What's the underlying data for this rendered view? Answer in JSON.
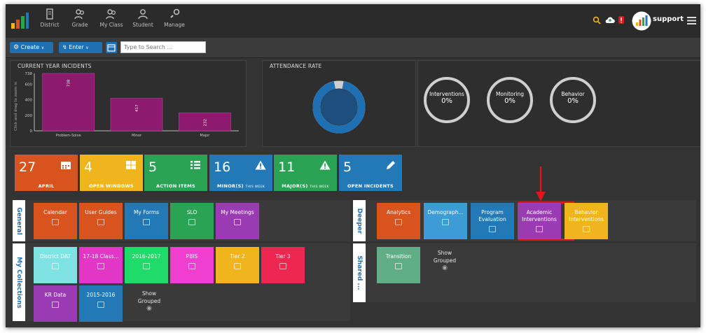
{
  "nav": {
    "items": [
      {
        "label": "District",
        "icon": "building-icon"
      },
      {
        "label": "Grade",
        "icon": "users-icon"
      },
      {
        "label": "My Class",
        "icon": "class-icon"
      },
      {
        "label": "Student",
        "icon": "user-icon"
      },
      {
        "label": "Manage",
        "icon": "manage-icon"
      }
    ],
    "user": "support"
  },
  "toolbar": {
    "create_label": "Create",
    "enter_label": "Enter",
    "search_placeholder": "Type to Search ..."
  },
  "panels": {
    "incidents_title": "CURRENT YEAR INCIDENTS",
    "incidents_axis_hint": "Click and drag to zoom in",
    "attendance_title": "ATTENDANCE RATE",
    "rings": [
      {
        "label": "Interventions",
        "value": "0%"
      },
      {
        "label": "Monitoring",
        "value": "0%"
      },
      {
        "label": "Behavior",
        "value": "0%"
      }
    ]
  },
  "chart_data": {
    "type": "bar",
    "title": "CURRENT YEAR INCIDENTS",
    "categories": [
      "Problem-Solve",
      "Minor",
      "Major"
    ],
    "values": [
      738,
      417,
      232
    ],
    "y_ticks": [
      "0",
      "200",
      "400",
      "600",
      "738"
    ],
    "ylim": [
      0,
      738
    ],
    "bar_color": "#8e1a6e"
  },
  "attendance": {
    "fraction": 0.94,
    "color": "#1f6fb3"
  },
  "stats": [
    {
      "num": "27",
      "label": "APRIL",
      "sub": "",
      "color": "#d9531e",
      "icon": "calendar-icon"
    },
    {
      "num": "4",
      "label": "OPEN WINDOWS",
      "sub": "",
      "color": "#f0b41c",
      "icon": "windows-icon"
    },
    {
      "num": "5",
      "label": "ACTION ITEMS",
      "sub": "",
      "color": "#2aa355",
      "icon": "list-icon"
    },
    {
      "num": "16",
      "label": "MINOR(S)",
      "sub": "THIS WEEK",
      "color": "#2279b5",
      "icon": "warning-icon"
    },
    {
      "num": "11",
      "label": "MAJOR(S)",
      "sub": "THIS WEEK",
      "color": "#2aa355",
      "icon": "warning-icon"
    },
    {
      "num": "5",
      "label": "OPEN INCIDENTS",
      "sub": "",
      "color": "#2279b5",
      "icon": "pencil-icon"
    }
  ],
  "groups": {
    "general": {
      "title": "General",
      "tiles": [
        {
          "label": "Calendar",
          "color": "#d9531e",
          "icon": "calendar-icon"
        },
        {
          "label": "User Guides",
          "color": "#d9531e",
          "icon": "help-icon"
        },
        {
          "label": "My Forms",
          "color": "#2279b5",
          "icon": "form-icon"
        },
        {
          "label": "SLO",
          "color": "#2aa355",
          "icon": "chart-icon"
        },
        {
          "label": "My Meetings",
          "color": "#9b3bb3",
          "icon": "meeting-icon"
        }
      ]
    },
    "collections": {
      "title": "My Collections",
      "tiles": [
        {
          "label": "District DAT",
          "color": "#7fe3e3",
          "icon": "collection-icon"
        },
        {
          "label": "17-18 Class...",
          "color": "#e236c7",
          "icon": "collection-icon"
        },
        {
          "label": "2016-2017",
          "color": "#1fdc6a",
          "icon": "collection-icon"
        },
        {
          "label": "PBIS",
          "color": "#ee3fd0",
          "icon": "collection-icon"
        },
        {
          "label": "Tier 2",
          "color": "#f0b41c",
          "icon": "collection-icon"
        },
        {
          "label": "Tier 3",
          "color": "#ee2751",
          "icon": "collection-icon"
        },
        {
          "label": "KR Data",
          "color": "#9b3bb3",
          "icon": "collection-icon"
        },
        {
          "label": "2015-2016",
          "color": "#2279b5",
          "icon": "collection-icon"
        }
      ],
      "show_grouped": "Show Grouped"
    },
    "deeper": {
      "title": "Deeper",
      "tiles": [
        {
          "label": "Analytics",
          "color": "#d9531e",
          "icon": "gears-icon"
        },
        {
          "label": "Demograph...",
          "color": "#3d9bd6",
          "icon": "percent-icon"
        },
        {
          "label": "Program Evaluation",
          "color": "#2279b5",
          "icon": "bar-chart-icon"
        },
        {
          "label": "Academic Interventions",
          "color": "#9b3bb3",
          "icon": "line-chart-icon"
        },
        {
          "label": "Behavior Interventions",
          "color": "#f0b41c",
          "icon": "line-chart-icon"
        }
      ]
    },
    "shared": {
      "title": "Shared ...",
      "tiles": [
        {
          "label": "Transition",
          "color": "#5fae85",
          "icon": "collection-icon"
        }
      ],
      "show_grouped": "Show Grouped"
    }
  },
  "highlight_color": "#e0161b"
}
